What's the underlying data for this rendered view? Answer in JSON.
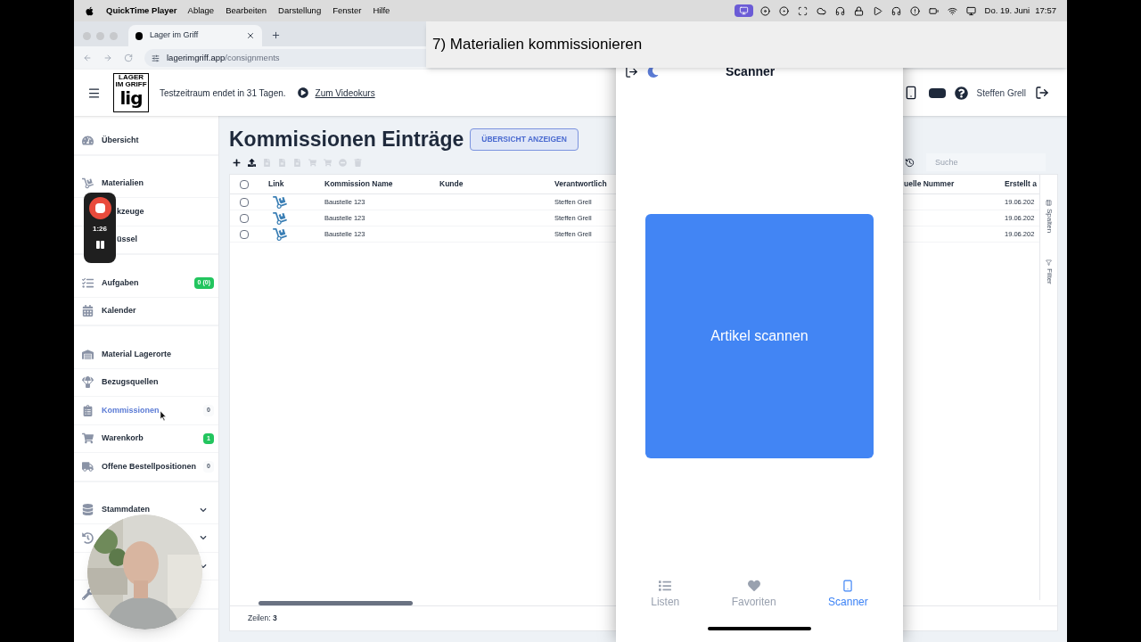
{
  "menubar": {
    "app": "QuickTime Player",
    "menus": [
      "Ablage",
      "Bearbeiten",
      "Darstellung",
      "Fenster",
      "Hilfe"
    ],
    "date": "Do. 19. Juni",
    "time": "17:57"
  },
  "browser": {
    "tab_title": "Lager im Griff",
    "url_host": "lagerimgriff.app",
    "url_path": "/consignments"
  },
  "overlay_title": "7) Materialien kommissionieren",
  "header": {
    "logo_caption": "LAGER IM GRIFF",
    "logo_mark": "lig",
    "trial": "Testzeitraum endet in 31 Tagen.",
    "video_link": "Zum Videokurs",
    "user": "Steffen Grell"
  },
  "recorder": {
    "time": "1:26"
  },
  "sidebar": {
    "groups": [
      [
        {
          "kind": "link",
          "label": "Übersicht",
          "selected": false
        }
      ],
      [
        {
          "kind": "link",
          "label": "Materialien",
          "selected": false
        },
        {
          "kind": "link",
          "label": "kzeuge",
          "selected": false
        },
        {
          "kind": "link",
          "label": "üssel",
          "selected": false
        }
      ],
      [
        {
          "kind": "link",
          "label": "Aufgaben",
          "selected": false,
          "badge": {
            "text": "0 (0)",
            "highlighted": true
          }
        },
        {
          "kind": "link",
          "label": "Kalender",
          "selected": false
        }
      ],
      [
        {
          "kind": "link",
          "label": "Material Lagerorte",
          "selected": false
        },
        {
          "kind": "link",
          "label": "Bezugsquellen",
          "selected": false
        },
        {
          "kind": "link",
          "label": "Kommissionen",
          "selected": true,
          "badge": {
            "text": "0",
            "highlighted": false
          }
        },
        {
          "kind": "link",
          "label": "Warenkorb",
          "selected": false,
          "badge": {
            "text": "1",
            "highlighted": true
          }
        },
        {
          "kind": "link",
          "label": "Offene Bestellpositionen",
          "selected": false,
          "badge": {
            "text": "0",
            "highlighted": false
          }
        }
      ],
      [
        {
          "kind": "expandable",
          "label": "Stammdaten"
        },
        {
          "kind": "expandable"
        },
        {
          "kind": "expandable"
        },
        {
          "kind": "link"
        }
      ]
    ]
  },
  "main": {
    "title": "Kommissionen Einträge",
    "overview_button": "ÜBERSICHT ANZEIGEN",
    "toolbar": [
      {
        "disabled": false
      },
      {
        "disabled": false
      },
      {
        "disabled": true
      },
      {
        "disabled": true
      },
      {
        "disabled": true
      },
      {
        "disabled": true
      },
      {
        "disabled": true
      },
      {
        "disabled": true
      },
      {
        "disabled": true
      }
    ],
    "search": {
      "placeholder": "Suche"
    },
    "table": {
      "all_checked": false,
      "columns": [
        "Link",
        "Kommission Name",
        "Kunde",
        "Verantwortlich",
        "uelle Nummer",
        "Erstellt a"
      ],
      "rows": [
        {
          "checked": false,
          "name": "Baustelle 123",
          "owner": "Steffen Grell",
          "created": "19.06.202"
        },
        {
          "checked": false,
          "name": "Baustelle 123",
          "owner": "Steffen Grell",
          "created": "19.06.202"
        },
        {
          "checked": false,
          "name": "Baustelle 123",
          "owner": "Steffen Grell",
          "created": "19.06.202"
        }
      ],
      "side_tabs": [
        "Spalten",
        "Filter"
      ],
      "footer": "Zeilen: **3**"
    }
  },
  "phone": {
    "title": "Scanner",
    "scan_button": "Artikel scannen",
    "tabs": [
      {
        "label": "Listen",
        "selected": false
      },
      {
        "label": "Favoriten",
        "selected": false
      },
      {
        "label": "Scanner",
        "selected": true
      }
    ]
  }
}
